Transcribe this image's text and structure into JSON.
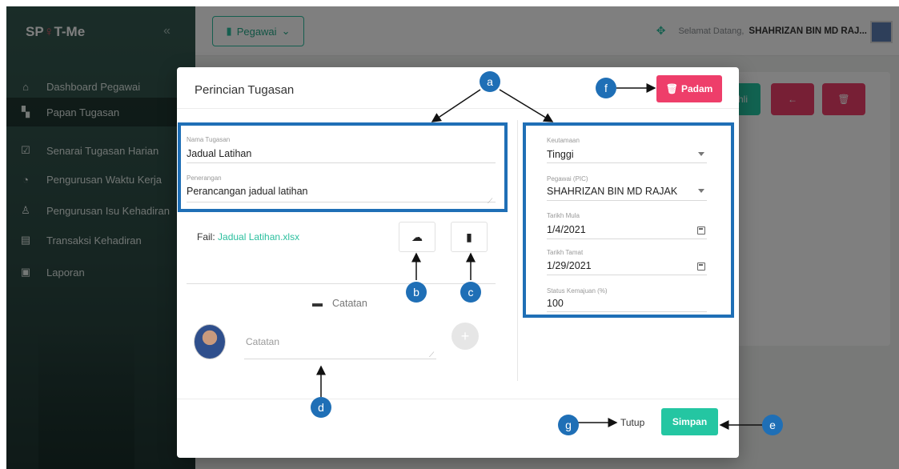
{
  "app": {
    "logo": "SP T-Me",
    "collapse_icon": "chevron-left-icon"
  },
  "sidebar": {
    "items": [
      {
        "label": "Dashboard Pegawai",
        "icon": "home-icon"
      },
      {
        "label": "Papan Tugasan",
        "icon": "board-icon",
        "active": true
      },
      {
        "label": "Senarai Tugasan Harian",
        "icon": "list-check-icon"
      },
      {
        "label": "Pengurusan Waktu Kerja",
        "icon": "clock-icon"
      },
      {
        "label": "Pengurusan Isu Kehadiran",
        "icon": "user-icon"
      },
      {
        "label": "Transaksi Kehadiran",
        "icon": "receipt-icon"
      },
      {
        "label": "Laporan",
        "icon": "report-icon"
      }
    ]
  },
  "topbar": {
    "pegawai_label": "Pegawai",
    "welcome_text": "Selamat Datang,",
    "user_name": "SHAHRIZAN BIN MD RAJ..."
  },
  "background_buttons": {
    "partial_label": "hli",
    "back_label": "←",
    "delete_label": "🗑"
  },
  "modal": {
    "title": "Perincian Tugasan",
    "delete_label": "Padam",
    "left": {
      "nama_label": "Nama Tugasan",
      "nama_value": "Jadual Latihan",
      "penerangan_label": "Penerangan",
      "penerangan_value": "Perancangan jadual latihan",
      "fail_prefix": "Fail:",
      "fail_name": "Jadual Latihan.xlsx"
    },
    "right": {
      "keutamaan_label": "Keutamaan",
      "keutamaan_value": "Tinggi",
      "pegawai_label": "Pegawai (PIC)",
      "pegawai_value": "SHAHRIZAN BIN MD RAJAK",
      "mula_label": "Tarikh Mula",
      "mula_value": "1/4/2021",
      "tamat_label": "Tarikh Tamat",
      "tamat_value": "1/29/2021",
      "status_label": "Status Kemajuan (%)",
      "status_value": "100"
    },
    "notes": {
      "heading": "Catatan",
      "placeholder": "Catatan",
      "add_label": "+"
    },
    "footer": {
      "close_label": "Tutup",
      "save_label": "Simpan"
    }
  },
  "annotations": {
    "a": "a",
    "b": "b",
    "c": "c",
    "d": "d",
    "e": "e",
    "f": "f",
    "g": "g"
  },
  "colors": {
    "accent": "#2bbf9e",
    "danger": "#ee3e6a",
    "annotation": "#1f6fb6"
  }
}
